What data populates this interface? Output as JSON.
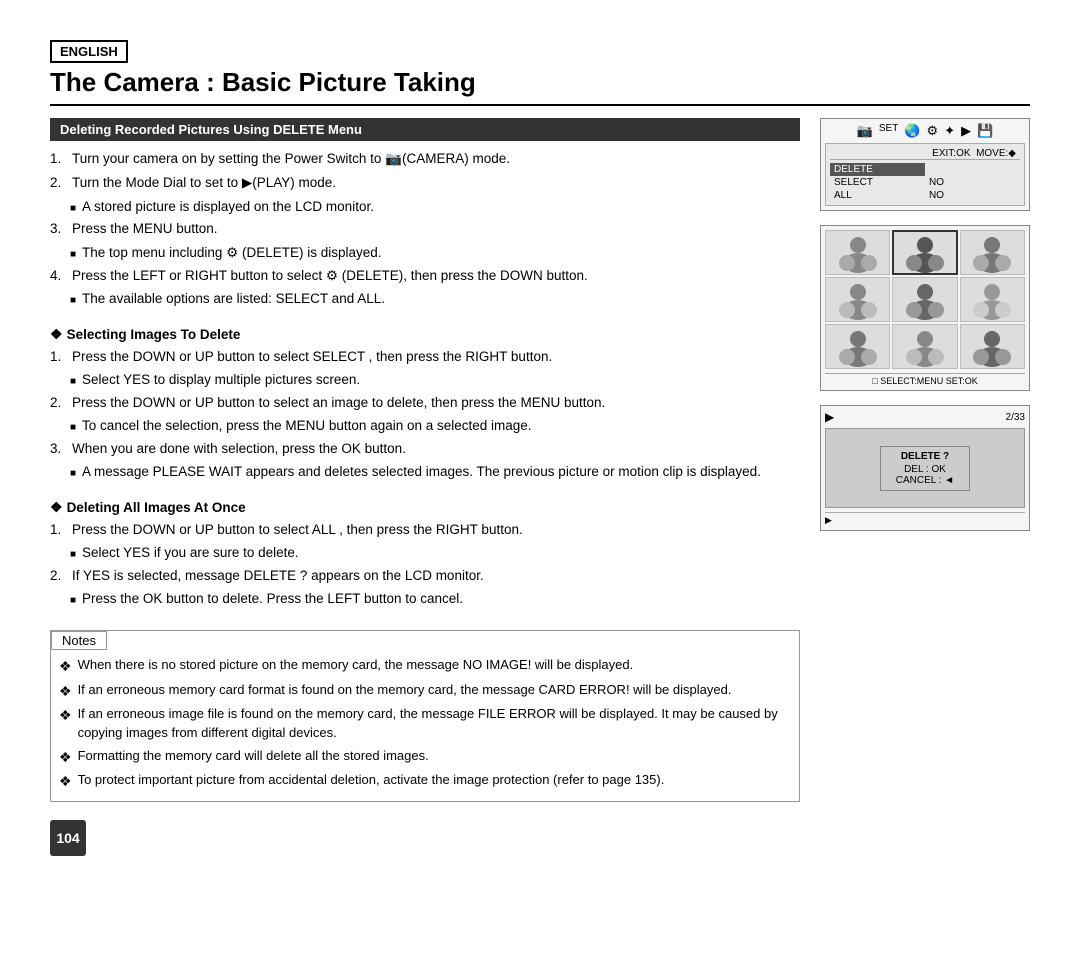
{
  "badge": "ENGLISH",
  "title": "The Camera : Basic Picture Taking",
  "section": {
    "header": "Deleting Recorded Pictures Using DELETE Menu"
  },
  "steps": [
    "Turn your camera on by setting the Power Switch to  (CAMERA) mode.",
    "Turn the Mode Dial to set to  (PLAY) mode.",
    "Press the MENU button.",
    "Press the LEFT or RIGHT button to select  (DELETE), then press the DOWN button."
  ],
  "step2_bullet": "A stored picture is displayed on the LCD monitor.",
  "step3_bullet": "The top menu including  (DELETE) is displayed.",
  "step4_bullet": "The available options are listed: SELECT and ALL.",
  "selecting_title": "Selecting Images To Delete",
  "selecting_steps": [
    "Press the DOWN or UP button to select  SELECT , then press the RIGHT button.",
    "Press the DOWN or UP button to select an image to delete, then press the MENU button.",
    "When you are done with selection, press the OK button."
  ],
  "select_step1_bullet": "Select  YES  to display multiple pictures screen.",
  "select_step2_bullet": "To cancel the selection, press the MENU button again on a selected image.",
  "select_step3_bullet": "A message  PLEASE WAIT  appears and deletes selected images. The previous picture or motion clip is displayed.",
  "deleting_title": "Deleting All Images At Once",
  "deleting_steps": [
    "Press the DOWN or UP button to select  ALL , then press the RIGHT button.",
    "If  YES  is selected, message  DELETE ?  appears on the LCD monitor."
  ],
  "delete_step1_bullet": "Select  YES  if you are sure to delete.",
  "delete_step2_bullet": "Press the OK button to delete. Press the LEFT button to cancel.",
  "notes_label": "Notes",
  "notes": [
    "When there is no stored picture on the memory card, the message  NO IMAGE!  will be displayed.",
    "If an erroneous memory card format is found on the memory card, the message  CARD ERROR!  will be displayed.",
    "If an erroneous image file is found on the memory card, the message  FILE ERROR  will be displayed. It may be caused by copying images from different digital devices.",
    "Formatting the memory card will delete all the stored images.",
    "To protect important picture from accidental deletion, activate the image protection (refer to page 135)."
  ],
  "page_number": "104",
  "cam_panel": {
    "menu_items": {
      "left": [
        "DELETE",
        "SELECT",
        "ALL"
      ],
      "right": [
        "EXIT:OK  MOVE:◆",
        "NO",
        "NO"
      ]
    }
  },
  "img_panel": {
    "bottom_bar": "□ SELECT:MENU  SET:OK"
  },
  "playback_panel": {
    "counter": "2/33",
    "dialog": {
      "title": "DELETE ?",
      "line1": "DEL : OK",
      "line2": "CANCEL : ◄"
    }
  }
}
